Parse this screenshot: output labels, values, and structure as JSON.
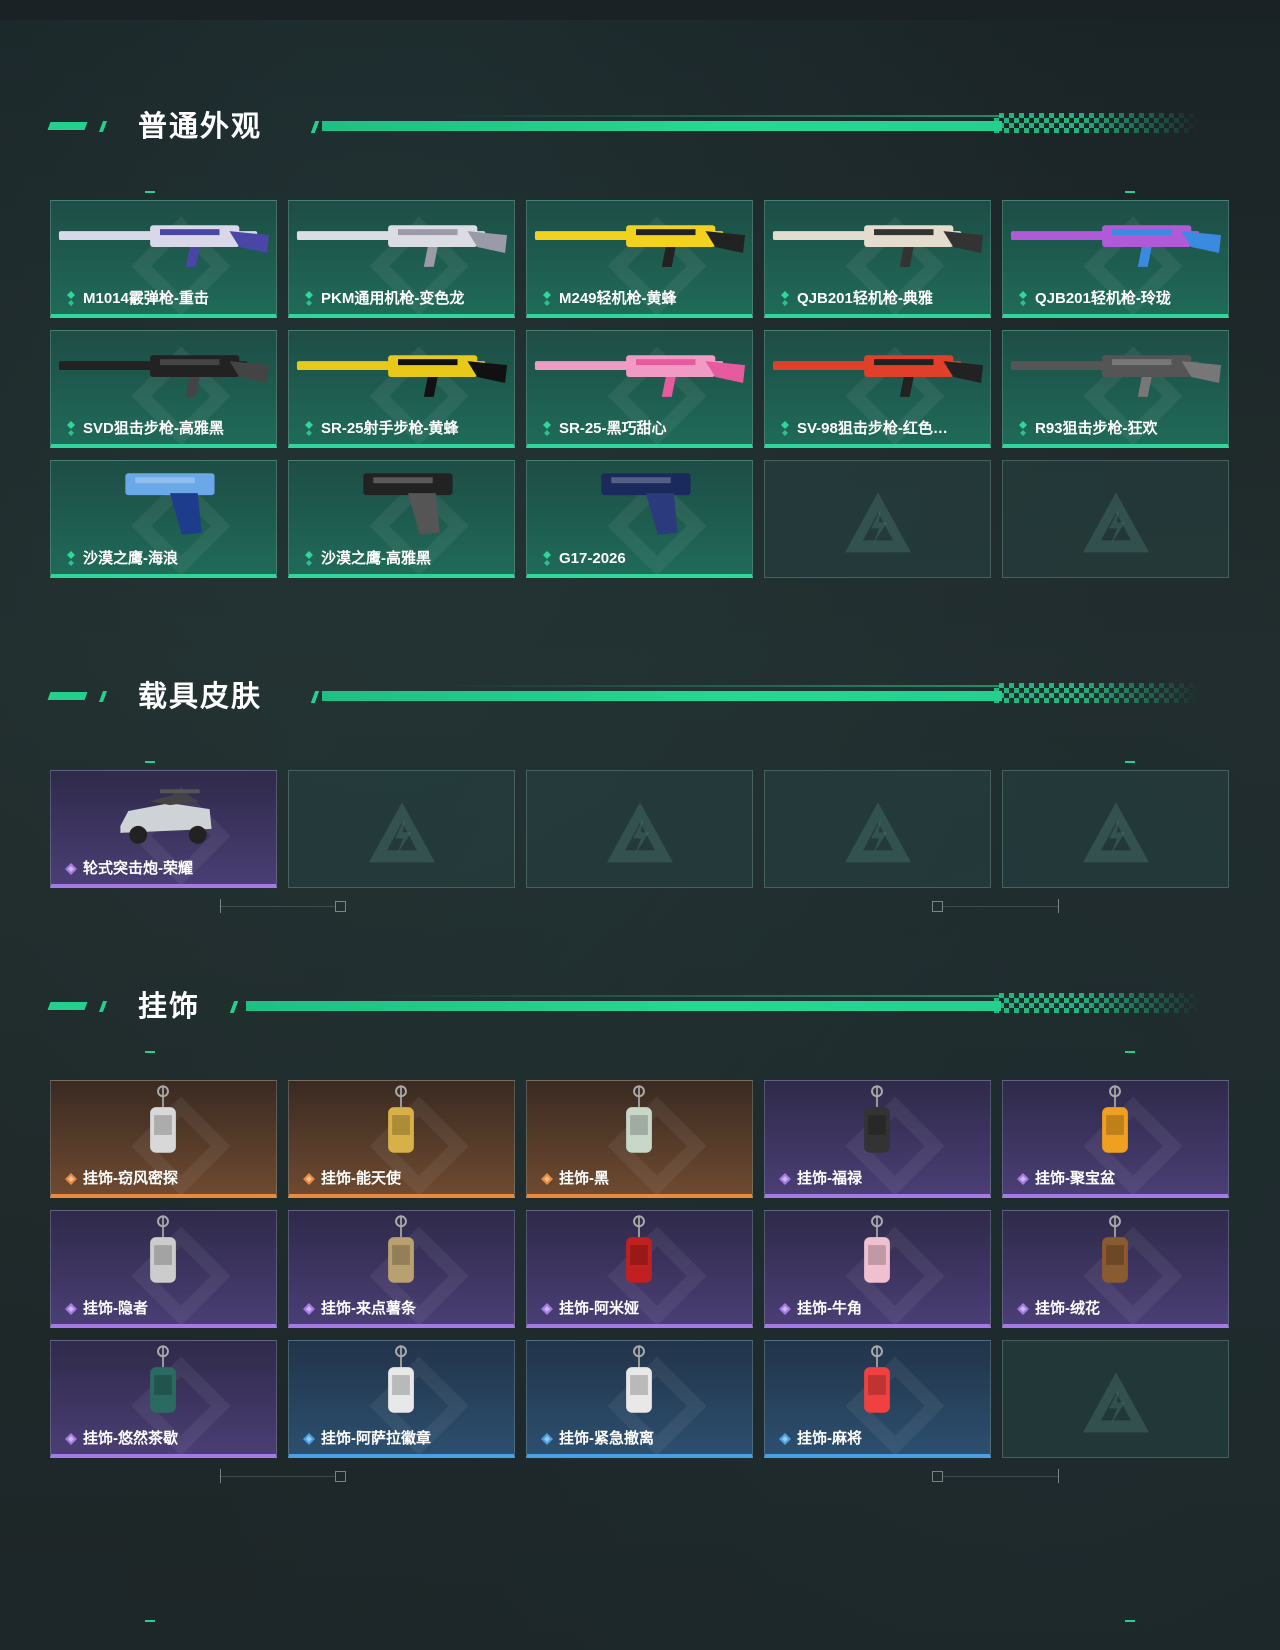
{
  "sections": [
    {
      "title": "普通外观",
      "items": [
        {
          "label": "M1014霰弹枪-重击",
          "rarity": "green",
          "icon": "shotgun-icon"
        },
        {
          "label": "PKM通用机枪-变色龙",
          "rarity": "green",
          "icon": "machine-gun-icon"
        },
        {
          "label": "M249轻机枪-黄蜂",
          "rarity": "green",
          "icon": "machine-gun-icon"
        },
        {
          "label": "QJB201轻机枪-典雅",
          "rarity": "green",
          "icon": "machine-gun-icon"
        },
        {
          "label": "QJB201轻机枪-玲珑",
          "rarity": "green",
          "icon": "machine-gun-icon"
        },
        {
          "label": "SVD狙击步枪-高雅黑",
          "rarity": "green",
          "icon": "sniper-rifle-icon"
        },
        {
          "label": "SR-25射手步枪-黄蜂",
          "rarity": "green",
          "icon": "rifle-icon"
        },
        {
          "label": "SR-25-黑巧甜心",
          "rarity": "green",
          "icon": "rifle-icon"
        },
        {
          "label": "SV-98狙击步枪-红色…",
          "rarity": "green",
          "icon": "sniper-rifle-icon"
        },
        {
          "label": "R93狙击步枪-狂欢",
          "rarity": "green",
          "icon": "sniper-rifle-icon"
        },
        {
          "label": "沙漠之鹰-海浪",
          "rarity": "green",
          "icon": "pistol-icon"
        },
        {
          "label": "沙漠之鹰-高雅黑",
          "rarity": "green",
          "icon": "pistol-icon"
        },
        {
          "label": "G17-2026",
          "rarity": "green",
          "icon": "pistol-icon"
        },
        {
          "label": "",
          "rarity": "empty"
        },
        {
          "label": "",
          "rarity": "empty"
        }
      ]
    },
    {
      "title": "载具皮肤",
      "items": [
        {
          "label": "轮式突击炮-荣耀",
          "rarity": "purple",
          "icon": "vehicle-icon"
        },
        {
          "label": "",
          "rarity": "empty"
        },
        {
          "label": "",
          "rarity": "empty"
        },
        {
          "label": "",
          "rarity": "empty"
        },
        {
          "label": "",
          "rarity": "empty"
        }
      ]
    },
    {
      "title": "挂饰",
      "items": [
        {
          "label": "挂饰-窃风密探",
          "rarity": "orange",
          "icon": "charm-icon"
        },
        {
          "label": "挂饰-能天使",
          "rarity": "orange",
          "icon": "charm-icon"
        },
        {
          "label": "挂饰-黑",
          "rarity": "orange",
          "icon": "charm-icon"
        },
        {
          "label": "挂饰-福禄",
          "rarity": "purple",
          "icon": "charm-icon"
        },
        {
          "label": "挂饰-聚宝盆",
          "rarity": "purple",
          "icon": "charm-icon"
        },
        {
          "label": "挂饰-隐者",
          "rarity": "purple",
          "icon": "charm-icon"
        },
        {
          "label": "挂饰-来点薯条",
          "rarity": "purple",
          "icon": "charm-icon"
        },
        {
          "label": "挂饰-阿米娅",
          "rarity": "purple",
          "icon": "charm-icon"
        },
        {
          "label": "挂饰-牛角",
          "rarity": "purple",
          "icon": "charm-icon"
        },
        {
          "label": "挂饰-绒花",
          "rarity": "purple",
          "icon": "charm-icon"
        },
        {
          "label": "挂饰-悠然茶歇",
          "rarity": "purple",
          "icon": "charm-icon"
        },
        {
          "label": "挂饰-阿萨拉徽章",
          "rarity": "blue",
          "icon": "charm-icon"
        },
        {
          "label": "挂饰-紧急撤离",
          "rarity": "blue",
          "icon": "charm-icon"
        },
        {
          "label": "挂饰-麻将",
          "rarity": "blue",
          "icon": "charm-icon"
        },
        {
          "label": "",
          "rarity": "empty"
        }
      ]
    }
  ],
  "colors": {
    "accent": "#24d08e",
    "green": "#2fd79a",
    "purple": "#a57ae6",
    "orange": "#e98a3f",
    "blue": "#4aa0e6"
  }
}
